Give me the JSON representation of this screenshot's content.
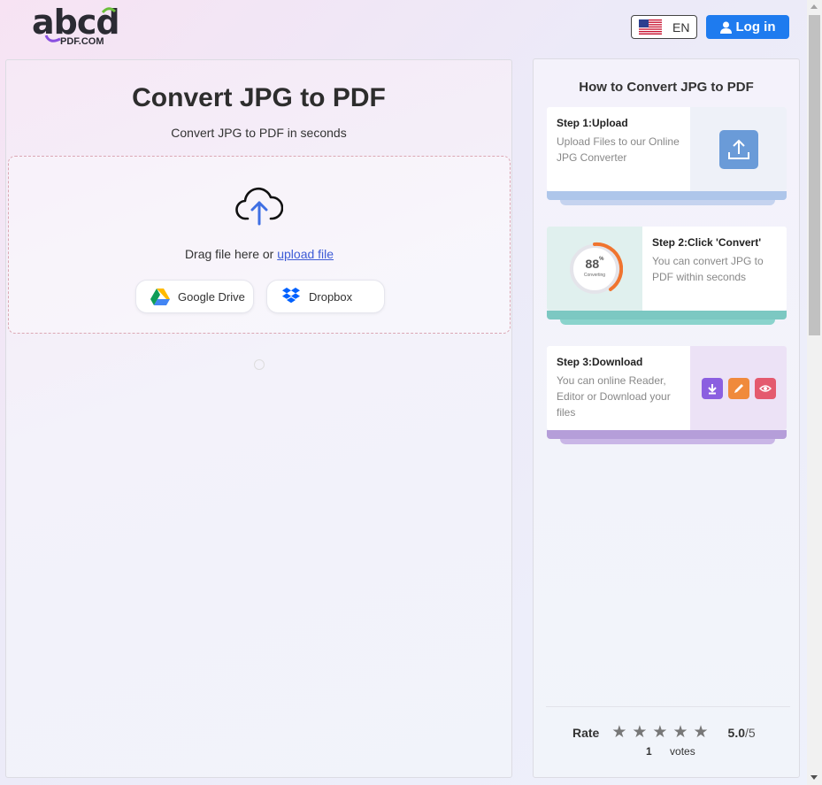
{
  "header": {
    "logo_main": "abcd",
    "logo_sub": "PDF.COM",
    "language": "EN",
    "login_label": "Log in"
  },
  "main": {
    "title": "Convert JPG to PDF",
    "subtitle": "Convert JPG to PDF in seconds",
    "drag_text": "Drag file here or",
    "upload_link": "upload file",
    "google_drive_label": "Google Drive",
    "dropbox_label": "Dropbox"
  },
  "side": {
    "title": "How to Convert JPG to PDF",
    "steps": [
      {
        "heading": "Step 1:Upload",
        "desc": "Upload Files to our Online JPG Converter"
      },
      {
        "heading": "Step 2:Click 'Convert'",
        "desc": "You can convert JPG to PDF within seconds",
        "progress_value": "88",
        "progress_unit": "%",
        "progress_label": "Converting"
      },
      {
        "heading": "Step 3:Download",
        "desc": "You can online Reader, Editor or Download your files"
      }
    ],
    "rating": {
      "label": "Rate",
      "stars": "★★★★★",
      "value": "5.0",
      "max": "/5",
      "votes_count": "1",
      "votes_label": "votes"
    }
  },
  "colors": {
    "accent": "#1e7bef",
    "step1": "#aec6ea",
    "step2": "#7cc8c2",
    "step3": "#b59ed9"
  }
}
